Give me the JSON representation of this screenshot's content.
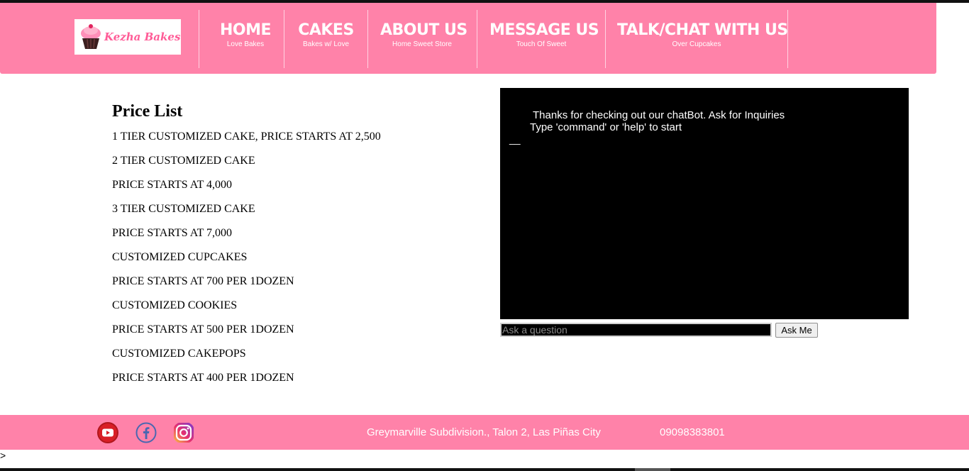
{
  "header": {
    "logo_text": "Kezha Bakes",
    "nav": [
      {
        "title": "HOME",
        "subtitle": "Love Bakes"
      },
      {
        "title": "CAKES",
        "subtitle": "Bakes w/ Love"
      },
      {
        "title": "ABOUT US",
        "subtitle": "Home Sweet Store"
      },
      {
        "title": "MESSAGE US",
        "subtitle": "Touch Of Sweet"
      },
      {
        "title": "TALK/CHAT WITH US",
        "subtitle": "Over Cupcakes"
      }
    ]
  },
  "price_list": {
    "heading": "Price List",
    "items": [
      "1 TIER CUSTOMIZED CAKE, PRICE STARTS AT 2,500",
      "2 TIER CUSTOMIZED CAKE",
      "PRICE STARTS AT 4,000",
      "3 TIER CUSTOMIZED CAKE",
      "PRICE STARTS AT 7,000",
      "CUSTOMIZED CUPCAKES",
      "PRICE STARTS AT 700 PER 1DOZEN",
      "CUSTOMIZED COOKIES",
      "PRICE STARTS AT 500 PER 1DOZEN",
      "CUSTOMIZED CAKEPOPS",
      "PRICE STARTS AT 400 PER 1DOZEN"
    ]
  },
  "chat": {
    "line1": "Thanks for checking out our chatBot. Ask for Inquiries",
    "line2": "Type 'command' or 'help' to start",
    "cursor": "__",
    "input_placeholder": "Ask a question",
    "input_value": "",
    "ask_button": "Ask Me"
  },
  "footer": {
    "social_icons": [
      "youtube-icon",
      "facebook-icon",
      "instagram-icon"
    ],
    "address": "Greymarville Subdivision., Talon 2, Las Piñas City",
    "phone": "09098383801"
  },
  "stray_char": ">",
  "colors": {
    "brand_pink": "#ff82a9",
    "chat_bg": "#000000",
    "logo_pink": "#ff5c97"
  }
}
